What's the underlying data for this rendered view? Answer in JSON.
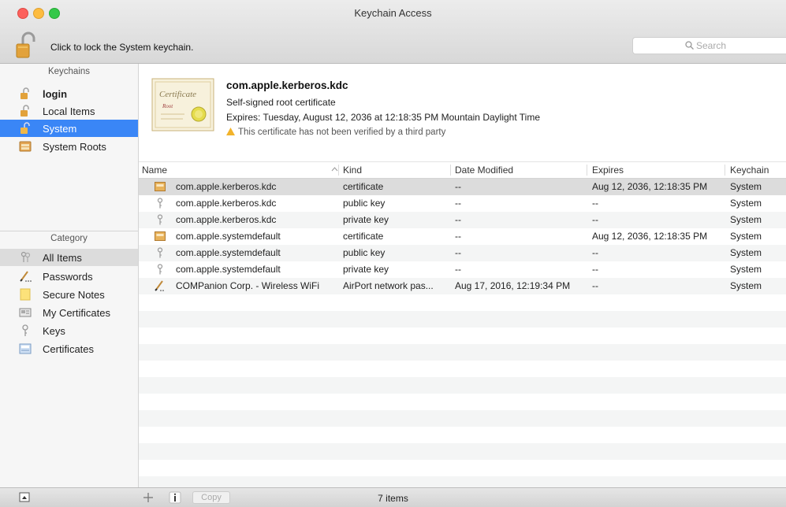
{
  "window": {
    "title": "Keychain Access"
  },
  "toolbar": {
    "lock_hint": "Click to lock the System keychain.",
    "search_placeholder": "Search"
  },
  "sidebar": {
    "keychains_title": "Keychains",
    "keychains": [
      {
        "label": "login",
        "icon": "lock-icon",
        "bold": true,
        "selected": false
      },
      {
        "label": "Local Items",
        "icon": "lock-icon",
        "bold": false,
        "selected": false
      },
      {
        "label": "System",
        "icon": "lock-open-icon",
        "bold": false,
        "selected": true
      },
      {
        "label": "System Roots",
        "icon": "cabinet-icon",
        "bold": false,
        "selected": false
      }
    ],
    "category_title": "Category",
    "categories": [
      {
        "label": "All Items",
        "icon": "keys-icon",
        "selected": true
      },
      {
        "label": "Passwords",
        "icon": "pen-icon",
        "selected": false
      },
      {
        "label": "Secure Notes",
        "icon": "note-icon",
        "selected": false
      },
      {
        "label": "My Certificates",
        "icon": "certificate-card-icon",
        "selected": false
      },
      {
        "label": "Keys",
        "icon": "key-icon",
        "selected": false
      },
      {
        "label": "Certificates",
        "icon": "certificate-icon",
        "selected": false
      }
    ]
  },
  "detail": {
    "name": "com.apple.kerberos.kdc",
    "type": "Self-signed root certificate",
    "expires": "Expires: Tuesday, August 12, 2036 at 12:18:35 PM Mountain Daylight Time",
    "warning": "This certificate has not been verified by a third party",
    "thumb_title": "Certificate",
    "thumb_subtitle": "Root"
  },
  "table": {
    "columns": [
      "Name",
      "Kind",
      "Date Modified",
      "Expires",
      "Keychain"
    ],
    "rows": [
      {
        "icon": "certificate-icon",
        "name": "com.apple.kerberos.kdc",
        "kind": "certificate",
        "modified": "--",
        "expires": "Aug 12, 2036, 12:18:35 PM",
        "keychain": "System"
      },
      {
        "icon": "key-icon",
        "name": "com.apple.kerberos.kdc",
        "kind": "public key",
        "modified": "--",
        "expires": "--",
        "keychain": "System"
      },
      {
        "icon": "key-icon",
        "name": "com.apple.kerberos.kdc",
        "kind": "private key",
        "modified": "--",
        "expires": "--",
        "keychain": "System"
      },
      {
        "icon": "certificate-icon",
        "name": "com.apple.systemdefault",
        "kind": "certificate",
        "modified": "--",
        "expires": "Aug 12, 2036, 12:18:35 PM",
        "keychain": "System"
      },
      {
        "icon": "key-icon",
        "name": "com.apple.systemdefault",
        "kind": "public key",
        "modified": "--",
        "expires": "--",
        "keychain": "System"
      },
      {
        "icon": "key-icon",
        "name": "com.apple.systemdefault",
        "kind": "private key",
        "modified": "--",
        "expires": "--",
        "keychain": "System"
      },
      {
        "icon": "pen-icon",
        "name": "COMPanion Corp. - Wireless WiFi",
        "kind": "AirPort network pas...",
        "modified": "Aug 17, 2016, 12:19:34 PM",
        "expires": "--",
        "keychain": "System"
      }
    ]
  },
  "bottombar": {
    "status": "7 items",
    "copy_label": "Copy"
  },
  "colors": {
    "selection": "#3a86f6",
    "row_selected": "#dcdcdc",
    "row_alt": "#f4f5f5",
    "lock_gold": "#e2a23b"
  }
}
